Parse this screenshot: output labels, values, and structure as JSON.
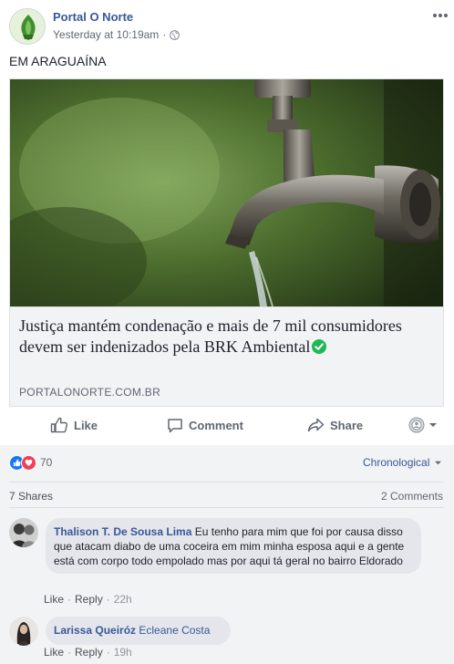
{
  "post": {
    "page_name": "Portal O Norte",
    "timestamp": "Yesterday at 10:19am",
    "meta_separator": "·",
    "text": "EM ARAGUAÍNA"
  },
  "link_card": {
    "title": "Justiça mantém condenação e mais de 7 mil consumidores devem ser indenizados pela BRK Ambiental",
    "domain": "PORTALONORTE.COM.BR"
  },
  "actions": {
    "like_label": "Like",
    "comment_label": "Comment",
    "share_label": "Share"
  },
  "reactions": {
    "count": "70",
    "sort_label": "Chronological"
  },
  "stats": {
    "shares": "7 Shares",
    "comments": "2 Comments"
  },
  "comments": [
    {
      "author": "Thalison T. De Sousa Lima",
      "text": "Eu tenho para mim que foi por causa disso que atacam diabo de uma coceira em mim minha esposa aqui e a gente está com corpo todo empolado mas por aqui tá geral no bairro Eldorado",
      "like": "Like",
      "reply": "Reply",
      "time": "22h"
    },
    {
      "author": "Larissa Queiróz",
      "text": "Ecleane Costa",
      "like": "Like",
      "reply": "Reply",
      "time": "19h"
    }
  ],
  "colors": {
    "link_blue": "#365899",
    "meta_gray": "#616770",
    "like_blue": "#1877f2",
    "love_red": "#f33e58",
    "verified_green": "#1db954"
  },
  "icons": [
    "page-logo-icon",
    "globe-icon",
    "more-options-icon",
    "verified-icon",
    "like-icon",
    "comment-icon",
    "share-icon",
    "audience-icon",
    "chevron-down-icon",
    "like-reaction-icon",
    "love-reaction-icon"
  ]
}
